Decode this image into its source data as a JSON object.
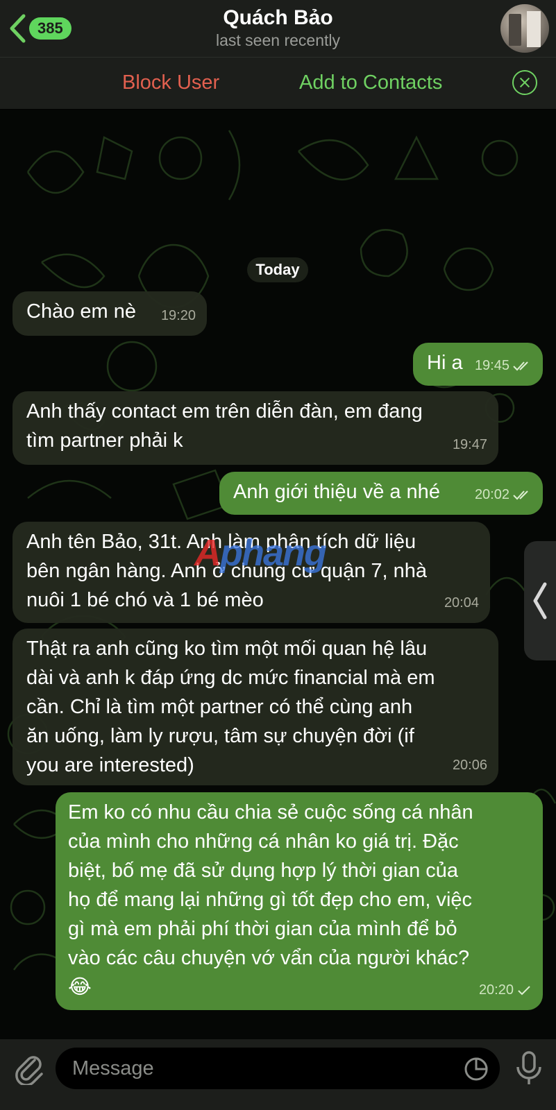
{
  "header": {
    "unread_count": "385",
    "title": "Quách Bảo",
    "subtitle": "last seen recently"
  },
  "actions": {
    "block_user": "Block User",
    "add_to_contacts": "Add to Contacts"
  },
  "chat": {
    "date_label": "Today",
    "messages": [
      {
        "direction": "in",
        "text": "Chào em nè",
        "time": "19:20"
      },
      {
        "direction": "out",
        "text": "Hi a",
        "time": "19:45",
        "status": "read"
      },
      {
        "direction": "in",
        "text": "Anh thấy contact em trên diễn đàn, em đang\ntìm partner phải k",
        "time": "19:47"
      },
      {
        "direction": "out",
        "text": "Anh giới thiệu về a nhé",
        "time": "20:02",
        "status": "read"
      },
      {
        "direction": "in",
        "text": "Anh tên Bảo, 31t. Anh làm phân tích dữ liệu\nbên ngân hàng. Anh ở chung cư quận 7, nhà\nnuôi 1 bé chó và 1 bé mèo",
        "time": "20:04"
      },
      {
        "direction": "in",
        "text": "Thật ra anh cũng ko tìm một mối quan hệ lâu\ndài và anh k đáp ứng dc mức financial mà em\ncần. Chỉ là tìm một partner có thể cùng anh\năn uống, làm ly rượu, tâm sự chuyện đời (if\nyou are interested)",
        "time": "20:06"
      },
      {
        "direction": "out",
        "text": "Em ko có nhu cầu chia sẻ cuộc sống cá nhân\ncủa mình cho những cá nhân ko giá trị. Đặc\nbiệt, bố mẹ đã sử dụng hợp lý thời gian của\nhọ để mang lại những gì tốt đẹp cho em, việc\ngì mà em phải phí thời gian của mình để bỏ\nvào các câu chuyện vớ vẩn của người khác?\n😂",
        "time": "20:20",
        "status": "sent"
      }
    ]
  },
  "watermark": {
    "text_a": "A",
    "text_b": "phang"
  },
  "input": {
    "placeholder": "Message"
  },
  "colors": {
    "accent_green": "#6fd162",
    "block_red": "#e2604f",
    "outgoing_bubble": "#4f8b36",
    "incoming_bubble": "#242a1e"
  },
  "icons": [
    "back-chevron-icon",
    "close-circle-icon",
    "paperclip-icon",
    "sticker-icon",
    "microphone-icon",
    "double-check-icon",
    "single-check-icon",
    "side-panel-chevron-icon"
  ]
}
